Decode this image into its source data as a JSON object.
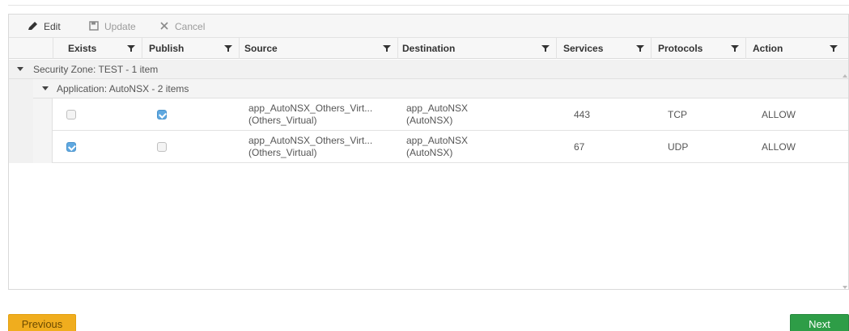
{
  "toolbar": {
    "edit_label": "Edit",
    "update_label": "Update",
    "cancel_label": "Cancel"
  },
  "columns": [
    "Exists",
    "Publish",
    "Source",
    "Destination",
    "Services",
    "Protocols",
    "Action"
  ],
  "groups": {
    "zone": "Security Zone: TEST - 1 item",
    "application": "Application: AutoNSX - 2 items"
  },
  "rows": [
    {
      "exists": false,
      "publish": true,
      "source_line1": "app_AutoNSX_Others_Virt...",
      "source_line2": "(Others_Virtual)",
      "destination_line1": "app_AutoNSX",
      "destination_line2": "(AutoNSX)",
      "services": "443",
      "protocols": "TCP",
      "action": "ALLOW"
    },
    {
      "exists": true,
      "publish": false,
      "source_line1": "app_AutoNSX_Others_Virt...",
      "source_line2": "(Others_Virtual)",
      "destination_line1": "app_AutoNSX",
      "destination_line2": "(AutoNSX)",
      "services": "67",
      "protocols": "UDP",
      "action": "ALLOW"
    }
  ],
  "footer": {
    "previous_label": "Previous",
    "next_label": "Next"
  },
  "colors": {
    "previous_bg": "#f0ad1e",
    "next_bg": "#2e9d47",
    "checkbox_checked": "#5fa8e0"
  }
}
